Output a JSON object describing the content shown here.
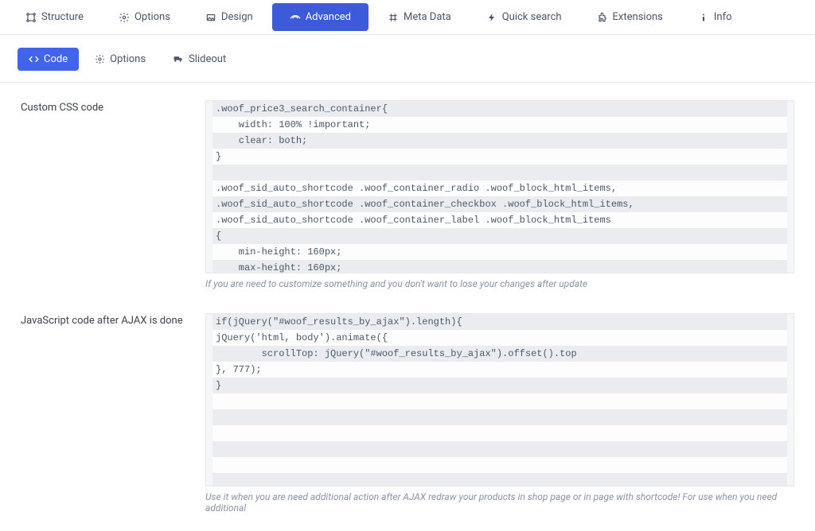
{
  "topTabs": [
    {
      "label": "Structure"
    },
    {
      "label": "Options"
    },
    {
      "label": "Design"
    },
    {
      "label": "Advanced"
    },
    {
      "label": "Meta Data"
    },
    {
      "label": "Quick search"
    },
    {
      "label": "Extensions"
    },
    {
      "label": "Info"
    }
  ],
  "subTabs": [
    {
      "label": "Code"
    },
    {
      "label": "Options"
    },
    {
      "label": "Slideout"
    }
  ],
  "fields": {
    "css": {
      "label": "Custom CSS code",
      "help": "If you are need to customize something and you don't want to lose your changes after update",
      "lines": [
        ".woof_price3_search_container{",
        "    width: 100% !important;",
        "    clear: both;",
        "}",
        "",
        ".woof_sid_auto_shortcode .woof_container_radio .woof_block_html_items,",
        ".woof_sid_auto_shortcode .woof_container_checkbox .woof_block_html_items,",
        ".woof_sid_auto_shortcode .woof_container_label .woof_block_html_items",
        "{",
        "    min-height: 160px;",
        "    max-height: 160px;"
      ]
    },
    "js": {
      "label": "JavaScript code after AJAX is done",
      "help": "Use it when you are need additional action after AJAX redraw your products in shop page or in page with shortcode! For use when you need additional",
      "lines": [
        "if(jQuery(\"#woof_results_by_ajax\").length){",
        "jQuery('html, body').animate({",
        "        scrollTop: jQuery(\"#woof_results_by_ajax\").offset().top",
        "}, 777);",
        "}",
        "",
        "",
        "",
        "",
        "",
        ""
      ]
    }
  }
}
